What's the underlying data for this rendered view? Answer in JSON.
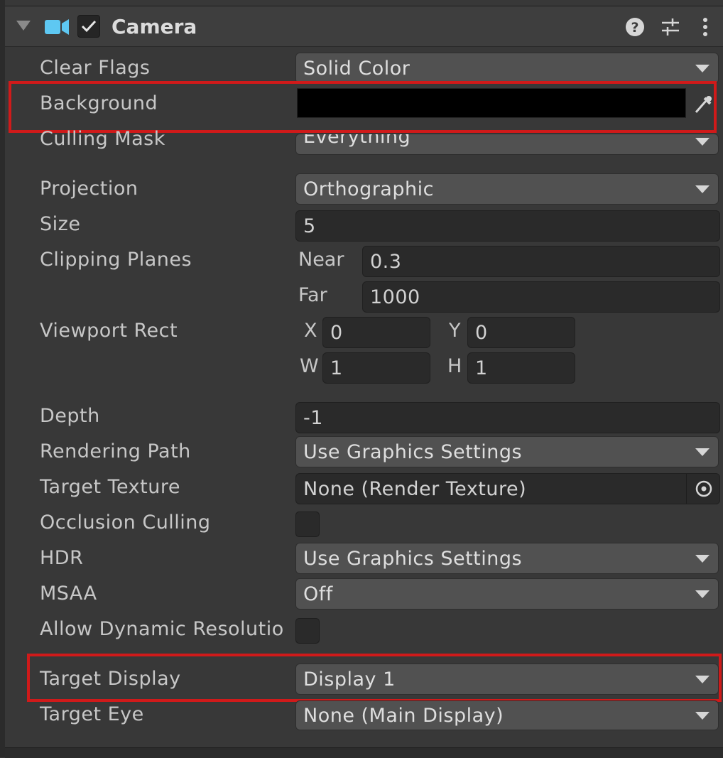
{
  "component": {
    "title": "Camera",
    "enabled": true,
    "icons": [
      "fold-triangle-icon",
      "camera-icon",
      "help-icon",
      "presets-icon",
      "more-menu-icon"
    ]
  },
  "properties": {
    "clear_flags": {
      "label": "Clear Flags",
      "value": "Solid Color"
    },
    "background": {
      "label": "Background",
      "color": "#000000"
    },
    "culling_mask": {
      "label": "Culling Mask",
      "value": "Everything"
    },
    "projection": {
      "label": "Projection",
      "value": "Orthographic"
    },
    "size": {
      "label": "Size",
      "value": "5"
    },
    "clipping_planes": {
      "label": "Clipping Planes",
      "near_label": "Near",
      "near": "0.3",
      "far_label": "Far",
      "far": "1000"
    },
    "viewport_rect": {
      "label": "Viewport Rect",
      "x_label": "X",
      "x": "0",
      "y_label": "Y",
      "y": "0",
      "w_label": "W",
      "w": "1",
      "h_label": "H",
      "h": "1"
    },
    "depth": {
      "label": "Depth",
      "value": "-1"
    },
    "rendering_path": {
      "label": "Rendering Path",
      "value": "Use Graphics Settings"
    },
    "target_texture": {
      "label": "Target Texture",
      "value": "None (Render Texture)"
    },
    "occlusion_culling": {
      "label": "Occlusion Culling",
      "checked": false
    },
    "hdr": {
      "label": "HDR",
      "value": "Use Graphics Settings"
    },
    "msaa": {
      "label": "MSAA",
      "value": "Off"
    },
    "allow_dynamic_resolution": {
      "label": "Allow Dynamic Resolutio",
      "checked": false
    },
    "target_display": {
      "label": "Target Display",
      "value": "Display 1"
    },
    "target_eye": {
      "label": "Target Eye",
      "value": "None (Main Display)"
    }
  },
  "annotations": {
    "highlight_color": "#d01a1a"
  }
}
